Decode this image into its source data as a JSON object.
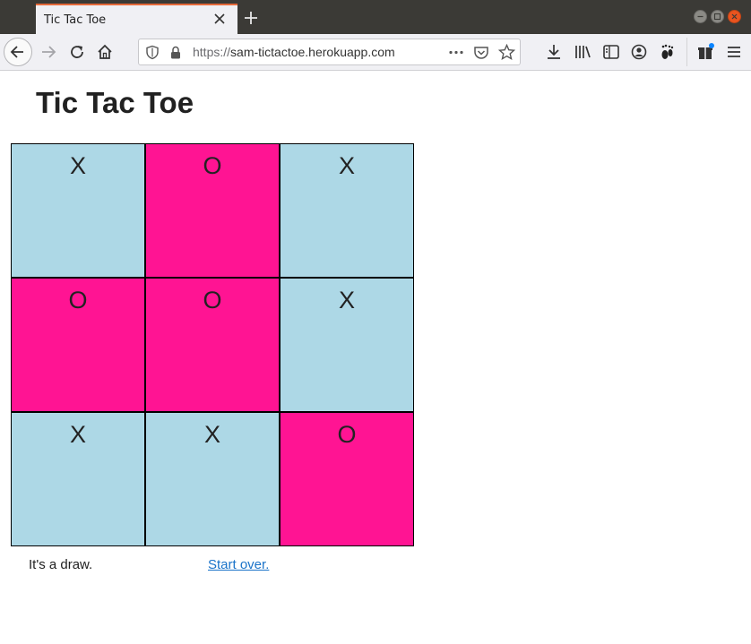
{
  "browser": {
    "tab_title": "Tic Tac Toe",
    "url_protocol": "https://",
    "url_host": "sam-tictactoe.herokuapp.com",
    "icons": [
      "back-icon",
      "forward-icon",
      "reload-icon",
      "home-icon",
      "shield-icon",
      "lock-icon",
      "more-icon",
      "pocket-icon",
      "bookmark-star-icon",
      "download-icon",
      "library-icon",
      "sidebar-icon",
      "account-icon",
      "extension-icon",
      "gift-icon",
      "menu-icon"
    ]
  },
  "page": {
    "title": "Tic Tac Toe",
    "status": "It's a draw.",
    "restart_label": "Start over."
  },
  "colors": {
    "x_cell": "#add8e6",
    "o_cell": "#ff1493",
    "link": "#1a73c9"
  },
  "board": [
    [
      "X",
      "O",
      "X"
    ],
    [
      "O",
      "O",
      "X"
    ],
    [
      "X",
      "X",
      "O"
    ]
  ]
}
